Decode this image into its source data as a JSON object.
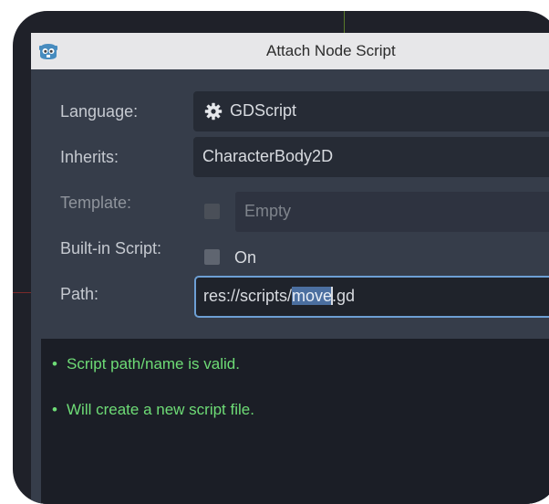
{
  "dialog": {
    "title": "Attach Node Script",
    "title_icon": "godot-icon"
  },
  "form": {
    "language": {
      "label": "Language:",
      "value": "GDScript",
      "icon": "gear-icon"
    },
    "inherits": {
      "label": "Inherits:",
      "value": "CharacterBody2D"
    },
    "template": {
      "label": "Template:",
      "value": "Empty",
      "checked": false,
      "enabled": false
    },
    "builtin": {
      "label": "Built-in Script:",
      "option": "On",
      "checked": false
    },
    "path": {
      "label": "Path:",
      "prefix": "res://scripts/",
      "selected": "move",
      "suffix": ".gd"
    }
  },
  "messages": [
    {
      "bullet": "•",
      "text": "Script path/name is valid."
    },
    {
      "bullet": "•",
      "text": "Will create a new script file."
    }
  ],
  "colors": {
    "dialog_bg": "#363d4a",
    "field_bg": "#262b35",
    "focus_border": "#6d9fd4",
    "selection": "#4b6fa0",
    "message_ok": "#6edc76"
  }
}
